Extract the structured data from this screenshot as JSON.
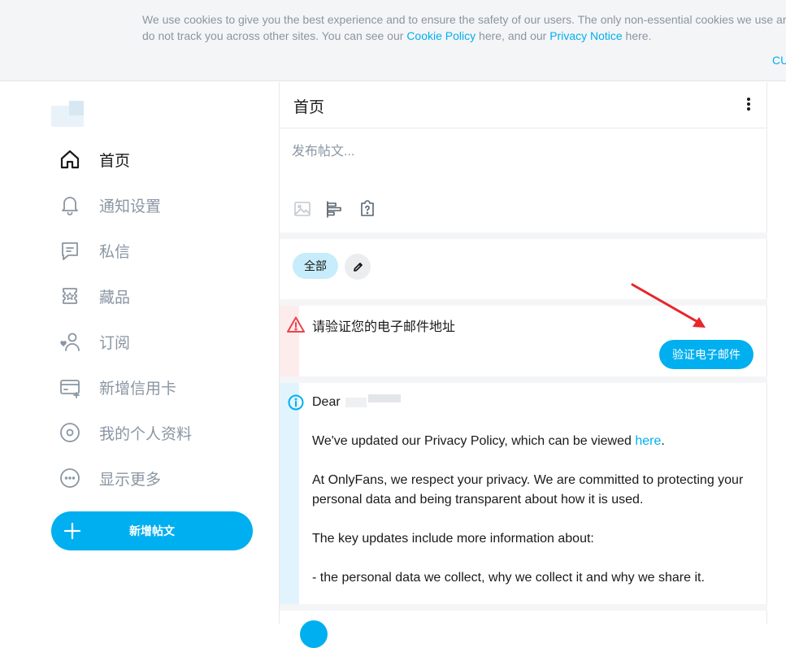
{
  "cookie_banner": {
    "text_before_policy": "We use cookies to give you the best experience and to ensure the safety of our users. The only non-essential cookies we use are for",
    "text_line2_start": "do not track you across other sites. You can see our ",
    "cookie_policy_link": "Cookie Policy",
    "text_middle": " here, and our ",
    "privacy_notice_link": "Privacy Notice",
    "text_end": " here.",
    "action_label": "CU"
  },
  "sidebar": {
    "items": [
      {
        "label": "首页",
        "icon": "home-icon",
        "active": true
      },
      {
        "label": "通知设置",
        "icon": "bell-icon",
        "active": false
      },
      {
        "label": "私信",
        "icon": "message-icon",
        "active": false
      },
      {
        "label": "藏品",
        "icon": "collections-icon",
        "active": false
      },
      {
        "label": "订阅",
        "icon": "subscriptions-icon",
        "active": false
      },
      {
        "label": "新增信用卡",
        "icon": "credit-card-icon",
        "active": false
      },
      {
        "label": "我的个人资料",
        "icon": "profile-icon",
        "active": false
      },
      {
        "label": "显示更多",
        "icon": "more-icon",
        "active": false
      }
    ],
    "new_post_label": "新增帖文"
  },
  "header": {
    "title": "首页"
  },
  "compose": {
    "placeholder": "发布帖文..."
  },
  "filters": {
    "all_label": "全部"
  },
  "verify_alert": {
    "text": "请验证您的电子邮件地址",
    "button_label": "验证电子邮件"
  },
  "info_alert": {
    "greeting": "Dear",
    "p1_text": "We've updated our Privacy Policy, which can be viewed ",
    "p1_link": "here",
    "p1_end": ".",
    "p2": "At OnlyFans, we respect your privacy. We are committed to protecting your personal data and being transparent about how it is used.",
    "p3": "The key updates include more information about:",
    "p4": "- the personal data we collect, why we collect it and why we share it."
  },
  "colors": {
    "accent": "#00aff0",
    "warning": "#e9454b",
    "muted": "#8a96a3",
    "annotation_arrow": "#e8262b"
  }
}
